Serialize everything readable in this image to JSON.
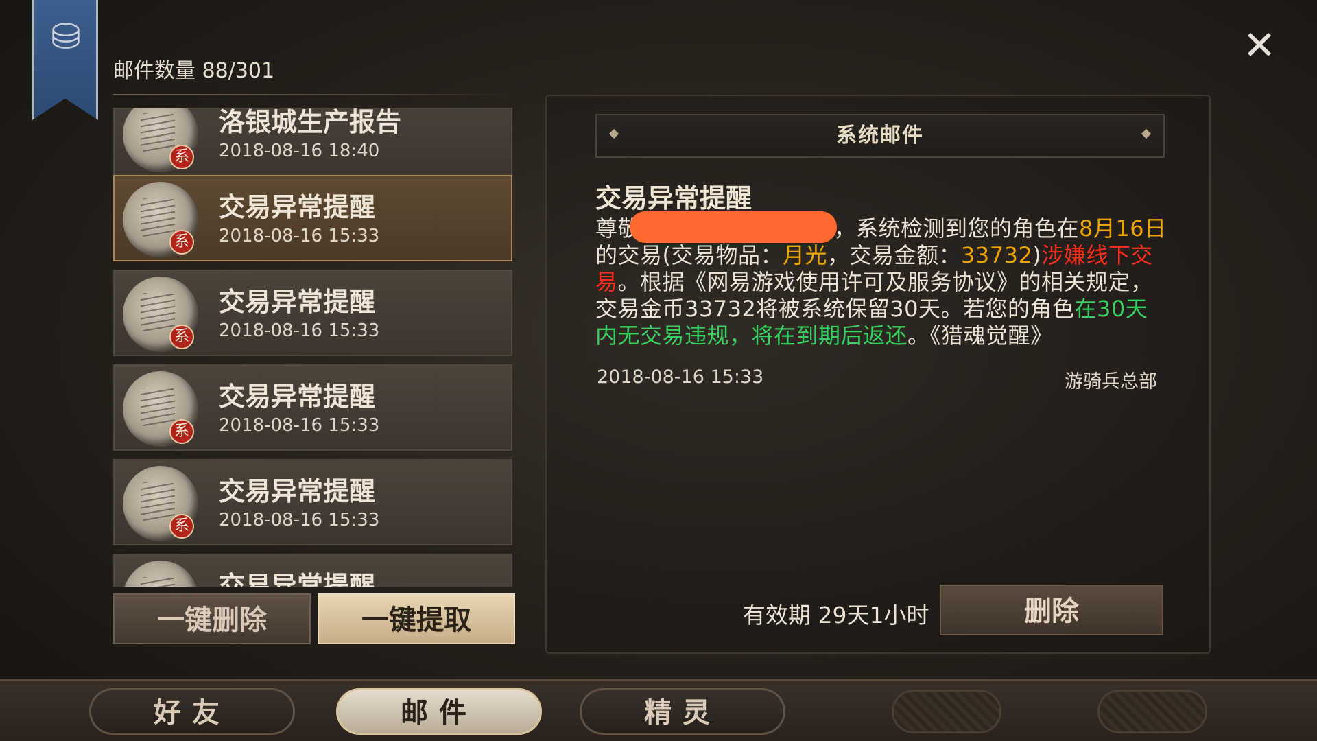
{
  "header": {
    "mail_count_label": "邮件数量 88/301",
    "close_symbol": "✕"
  },
  "mail_list": [
    {
      "title": "洛银城生产报告",
      "date": "2018-08-16 18:40",
      "badge": "系"
    },
    {
      "title": "交易异常提醒",
      "date": "2018-08-16 15:33",
      "badge": "系",
      "selected": true
    },
    {
      "title": "交易异常提醒",
      "date": "2018-08-16 15:33",
      "badge": "系"
    },
    {
      "title": "交易异常提醒",
      "date": "2018-08-16 15:33",
      "badge": "系"
    },
    {
      "title": "交易异常提醒",
      "date": "2018-08-16 15:33",
      "badge": "系"
    },
    {
      "title": "交易异常提醒",
      "date": "",
      "badge": ""
    }
  ],
  "list_buttons": {
    "delete_all": "一键删除",
    "collect_all": "一键提取"
  },
  "detail": {
    "header": "系统邮件",
    "title": "交易异常提醒",
    "body": {
      "p1": "尊敬的",
      "p2": "，系统检测到您的角色在",
      "date": "8月16日",
      "p3": "的交易(交易物品：",
      "item": "月光",
      "p4": "，交易金额：",
      "amount": "33732",
      "p5": ")",
      "suspect": "涉嫌线下交易",
      "p6": "。根据《网易游戏使用许可及服务协议》的相关规定，交易金币33732将被系统保留30天。若您的角色",
      "green": "在30天内无交易违规，将在到期后返还",
      "p7": "。《猎魂觉醒》"
    },
    "date": "2018-08-16 15:33",
    "sender": "游骑兵总部",
    "expiry": "有效期 29天1小时",
    "delete_button": "删除"
  },
  "tabs": [
    {
      "label": "好友",
      "active": false
    },
    {
      "label": "邮件",
      "active": true
    },
    {
      "label": "精灵",
      "active": false
    }
  ],
  "colors": {
    "highlight_yellow": "#f0a400",
    "highlight_red": "#ff2c1c",
    "highlight_green": "#38d060",
    "system_badge": "#b1241b",
    "banner_blue": "#3c5f8e"
  },
  "icons": [
    "mail-tube-icon",
    "close-icon",
    "scroll-icon",
    "system-badge-icon"
  ]
}
